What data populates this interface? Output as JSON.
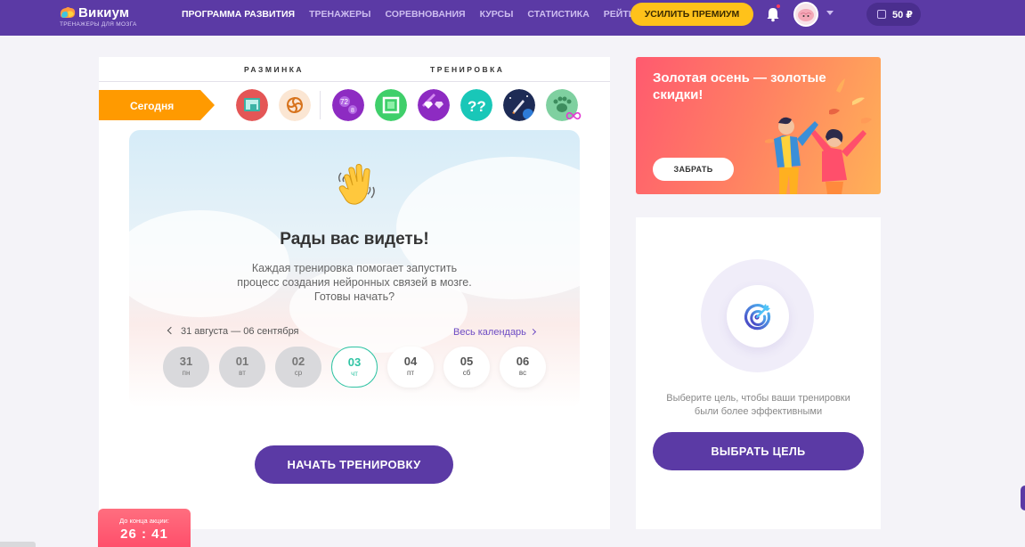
{
  "header": {
    "logo_name": "Викиум",
    "logo_sub": "ТРЕНАЖЕРЫ ДЛЯ МОЗГА",
    "nav": [
      {
        "label": "ПРОГРАММА РАЗВИТИЯ",
        "active": true
      },
      {
        "label": "ТРЕНАЖЕРЫ",
        "active": false
      },
      {
        "label": "СОРЕВНОВАНИЯ",
        "active": false
      },
      {
        "label": "КУРСЫ",
        "active": false
      },
      {
        "label": "СТАТИСТИКА",
        "active": false
      },
      {
        "label": "РЕЙТИНГ",
        "active": false
      }
    ],
    "premium_label": "УСИЛИТЬ ПРЕМИУМ",
    "balance": "50 ₽",
    "colors": {
      "bar": "#5b3aa5",
      "premium": "#ffc21a"
    }
  },
  "training": {
    "warmup_label": "РАЗМИНКА",
    "training_label": "ТРЕНИРОВКА",
    "today_label": "Сегодня",
    "warmup_games": [
      "picture-game-icon",
      "spiral-game-icon"
    ],
    "training_games": [
      "numbers-game-icon",
      "square-frame-game-icon",
      "diamonds-game-icon",
      "question-marks-game-icon",
      "rocket-game-icon",
      "paw-game-icon"
    ],
    "welcome_title": "Рады вас видеть!",
    "welcome_text": "Каждая тренировка помогает запустить процесс создания нейронных связей в мозге. Готовы начать?",
    "date_range": "31 августа — 06 сентября",
    "calendar_link": "Весь календарь",
    "days": [
      {
        "num": "31",
        "dow": "пн",
        "state": "past"
      },
      {
        "num": "01",
        "dow": "вт",
        "state": "past"
      },
      {
        "num": "02",
        "dow": "ср",
        "state": "past"
      },
      {
        "num": "03",
        "dow": "чт",
        "state": "today"
      },
      {
        "num": "04",
        "dow": "пт",
        "state": "future"
      },
      {
        "num": "05",
        "dow": "сб",
        "state": "future"
      },
      {
        "num": "06",
        "dow": "вс",
        "state": "future"
      }
    ],
    "start_button": "НАЧАТЬ ТРЕНИРОВКУ"
  },
  "promo_timer": {
    "label": "До конца акции:",
    "time": "26 : 41"
  },
  "banner": {
    "title": "Золотая осень — золотые скидки!",
    "button": "ЗАБРАТЬ"
  },
  "goal": {
    "text": "Выберите цель, чтобы ваши тренировки были более эффективными",
    "button": "ВЫБРАТЬ ЦЕЛЬ"
  }
}
